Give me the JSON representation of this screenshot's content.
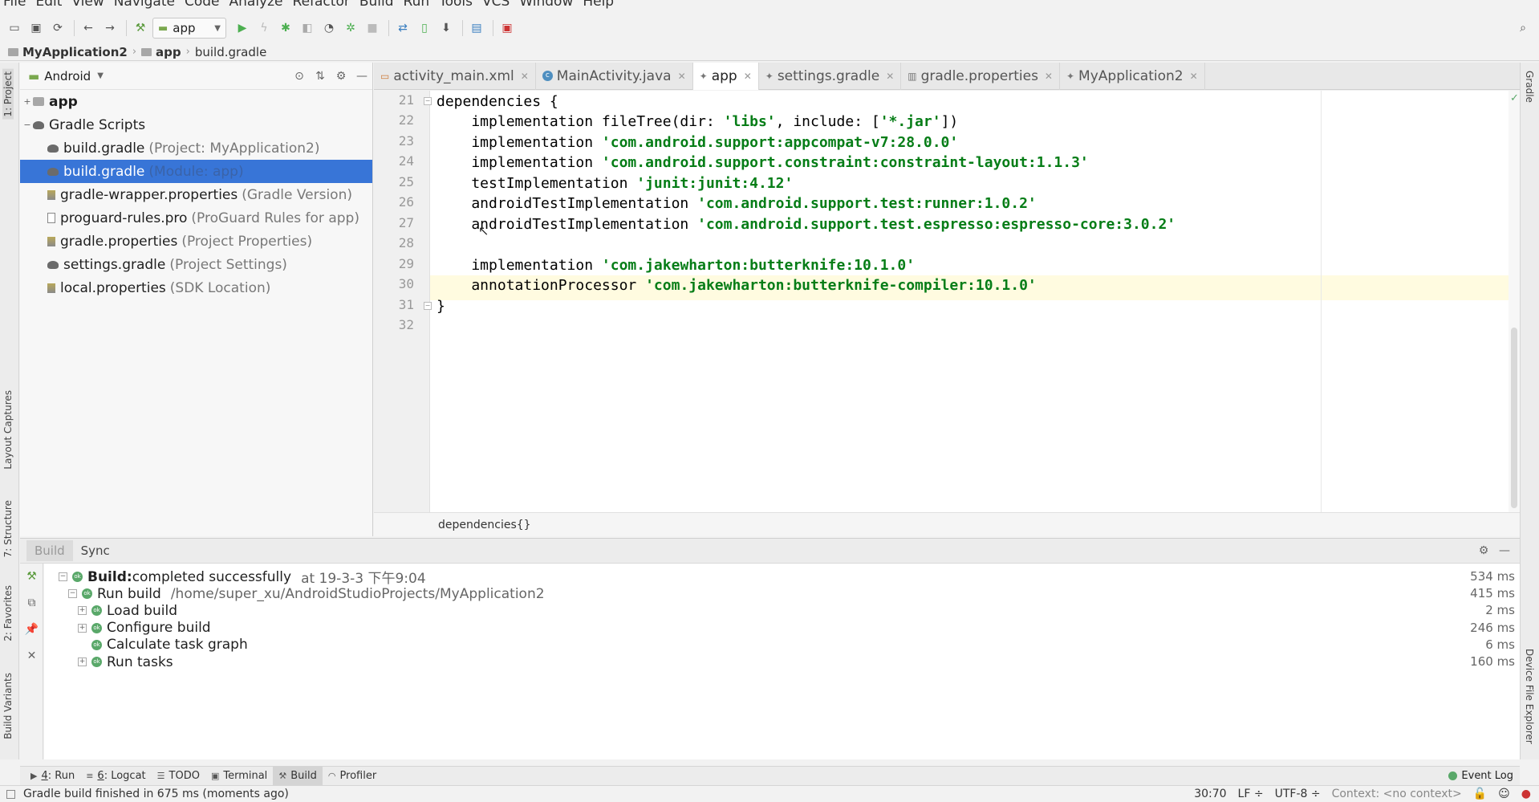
{
  "menu": [
    "File",
    "Edit",
    "View",
    "Navigate",
    "Code",
    "Analyze",
    "Refactor",
    "Build",
    "Run",
    "Tools",
    "VCS",
    "Window",
    "Help"
  ],
  "toolbar": {
    "run_config": "app"
  },
  "breadcrumb": [
    "MyApplication2",
    "app",
    "build.gradle"
  ],
  "left_strip": {
    "project": "1: Project",
    "captures": "Layout Captures",
    "structure": "7: Structure",
    "favorites": "2: Favorites",
    "variants": "Build Variants"
  },
  "right_strip": {
    "gradle": "Gradle",
    "device_explorer": "Device File Explorer"
  },
  "project_panel": {
    "view": "Android",
    "items": [
      {
        "label": "app",
        "hint": "",
        "icon": "folder-icon"
      },
      {
        "label": "Gradle Scripts",
        "hint": "",
        "icon": "gradle-icon"
      },
      {
        "label": "build.gradle",
        "hint": "(Project: MyApplication2)",
        "icon": "gradle-icon"
      },
      {
        "label": "build.gradle",
        "hint": "(Module: app)",
        "icon": "gradle-icon"
      },
      {
        "label": "gradle-wrapper.properties",
        "hint": "(Gradle Version)",
        "icon": "properties-icon"
      },
      {
        "label": "proguard-rules.pro",
        "hint": "(ProGuard Rules for app)",
        "icon": "file-icon"
      },
      {
        "label": "gradle.properties",
        "hint": "(Project Properties)",
        "icon": "properties-icon"
      },
      {
        "label": "settings.gradle",
        "hint": "(Project Settings)",
        "icon": "gradle-icon"
      },
      {
        "label": "local.properties",
        "hint": "(SDK Location)",
        "icon": "properties-icon"
      }
    ]
  },
  "tabs": [
    {
      "label": "activity_main.xml",
      "active": false
    },
    {
      "label": "MainActivity.java",
      "active": false
    },
    {
      "label": "app",
      "active": true
    },
    {
      "label": "settings.gradle",
      "active": false
    },
    {
      "label": "gradle.properties",
      "active": false
    },
    {
      "label": "MyApplication2",
      "active": false
    }
  ],
  "editor": {
    "line_numbers": [
      "21",
      "22",
      "23",
      "24",
      "25",
      "26",
      "27",
      "28",
      "29",
      "30",
      "31",
      "32"
    ],
    "lines": [
      {
        "plain": "dependencies {",
        "str": "",
        "tail": ""
      },
      {
        "plain": "    implementation fileTree(dir: ",
        "str": "'libs'",
        "tail": ", include: [",
        "str2": "'*.jar'",
        "tail2": "])"
      },
      {
        "plain": "    implementation ",
        "str": "'com.android.support:appcompat-v7:28.0.0'",
        "tail": ""
      },
      {
        "plain": "    implementation ",
        "str": "'com.android.support.constraint:constraint-layout:1.1.3'",
        "tail": ""
      },
      {
        "plain": "    testImplementation ",
        "str": "'junit:junit:4.12'",
        "tail": ""
      },
      {
        "plain": "    androidTestImplementation ",
        "str": "'com.android.support.test:runner:1.0.2'",
        "tail": ""
      },
      {
        "plain": "    androidTestImplementation ",
        "str": "'com.android.support.test.espresso:espresso-core:3.0.2'",
        "tail": ""
      },
      {
        "plain": "",
        "str": "",
        "tail": ""
      },
      {
        "plain": "    implementation ",
        "str": "'com.jakewharton:butterknife:10.1.0'",
        "tail": ""
      },
      {
        "plain": "    annotationProcessor ",
        "str": "'com.jakewharton:butterknife-compiler:10.1.0'",
        "tail": ""
      },
      {
        "plain": "}",
        "str": "",
        "tail": ""
      },
      {
        "plain": "",
        "str": "",
        "tail": ""
      }
    ],
    "code_breadcrumb": "dependencies{}"
  },
  "build_panel": {
    "tabs": [
      "Build",
      "Sync"
    ],
    "rows": [
      {
        "bold": "Build:",
        "text": " completed successfully",
        "extra": "at 19-3-3 下午9:04",
        "duration": "534 ms"
      },
      {
        "bold": "",
        "text": "Run build",
        "extra": "/home/super_xu/AndroidStudioProjects/MyApplication2",
        "duration": "415 ms"
      },
      {
        "bold": "",
        "text": "Load build",
        "extra": "",
        "duration": "2 ms"
      },
      {
        "bold": "",
        "text": "Configure build",
        "extra": "",
        "duration": "246 ms"
      },
      {
        "bold": "",
        "text": "Calculate task graph",
        "extra": "",
        "duration": "6 ms"
      },
      {
        "bold": "",
        "text": "Run tasks",
        "extra": "",
        "duration": "160 ms"
      }
    ]
  },
  "bottom_tools": [
    {
      "mnemonic": "4",
      "label": ": Run",
      "icon": "play-icon",
      "active": false
    },
    {
      "mnemonic": "6",
      "label": ": Logcat",
      "icon": "logcat-icon",
      "active": false
    },
    {
      "mnemonic": "",
      "label": "TODO",
      "icon": "list-icon",
      "active": false
    },
    {
      "mnemonic": "",
      "label": "Terminal",
      "icon": "terminal-icon",
      "active": false
    },
    {
      "mnemonic": "",
      "label": "Build",
      "icon": "hammer-icon",
      "active": true
    },
    {
      "mnemonic": "",
      "label": "Profiler",
      "icon": "gauge-icon",
      "active": false
    }
  ],
  "event_log": "Event Log",
  "status": {
    "message": "Gradle build finished in 675 ms (moments ago)",
    "position": "30:70",
    "line_sep": "LF ÷",
    "encoding": "UTF-8 ÷",
    "context": "Context: <no context>"
  },
  "colors": {
    "selection": "#3875d7",
    "string": "#067d17",
    "success": "#59a869"
  }
}
